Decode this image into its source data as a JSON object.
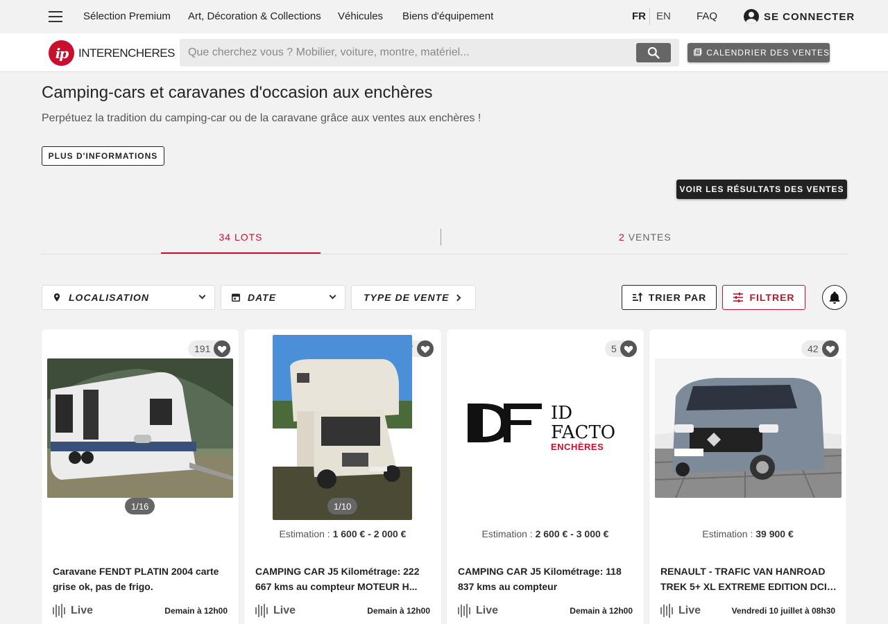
{
  "topnav": {
    "links": [
      "Sélection Premium",
      "Art, Décoration & Collections",
      "Véhicules",
      "Biens d'équipement"
    ],
    "lang_fr": "FR",
    "lang_en": "EN",
    "faq": "FAQ",
    "login": "SE CONNECTER"
  },
  "header": {
    "logo_mark": "ip",
    "logo_text": "INTERENCHERES",
    "search_placeholder": "Que cherchez vous ? Mobilier, voiture, montre, matériel...",
    "calendar_label": "CALENDRIER DES VENTES"
  },
  "intro": {
    "title": "Camping-cars et caravanes d'occasion aux enchères",
    "subtitle": "Perpétuez la tradition du camping-car ou de la caravane grâce aux ventes aux enchères !",
    "info_button": "PLUS D'INFORMATIONS",
    "results_button": "VOIR LES RÉSULTATS DES VENTES"
  },
  "tabs": {
    "lots": "34 LOTS",
    "ventes_count": "2",
    "ventes_label": "VENTES"
  },
  "filters": {
    "location": "LOCALISATION",
    "date": "DATE",
    "sale_type": "TYPE DE VENTE",
    "sort": "TRIER PAR",
    "filter": "FILTRER"
  },
  "lots": [
    {
      "favorites": "191",
      "counter": "1/16",
      "estimate_label": "",
      "estimate_value": "",
      "title": "Caravane FENDT PLATIN 2004 carte grise ok, pas de frigo.",
      "live": "Live",
      "date": "Demain à 12h00"
    },
    {
      "favorites": "17",
      "counter": "1/10",
      "estimate_label": "Estimation : ",
      "estimate_value": "1 600 € - 2 000 €",
      "title": "CAMPING CAR J5 Kilométrage: 222 667 kms au compteur MOTEUR H...",
      "live": "Live",
      "date": "Demain à 12h00"
    },
    {
      "favorites": "5",
      "counter": "",
      "estimate_label": "Estimation : ",
      "estimate_value": "2 600 € - 3 000 €",
      "title": "CAMPING CAR J5 Kilométrage: 118 837 kms au compteur",
      "live": "Live",
      "date": "Demain à 12h00",
      "logo_line1": "ID",
      "logo_line2": "FACTO",
      "logo_line3": "ENCHÈRES"
    },
    {
      "favorites": "42",
      "counter": "",
      "estimate_label": "Estimation : ",
      "estimate_value": "39 900 €",
      "title": "RENAULT - TRAFIC VAN HANROAD TREK 5+ XL EXTREME EDITION DCI ...",
      "live": "Live",
      "date": "Vendredi 10 juillet à 08h30"
    }
  ],
  "colors": {
    "brand": "#c8102e",
    "dark": "#222222",
    "button_grey": "#666666"
  }
}
